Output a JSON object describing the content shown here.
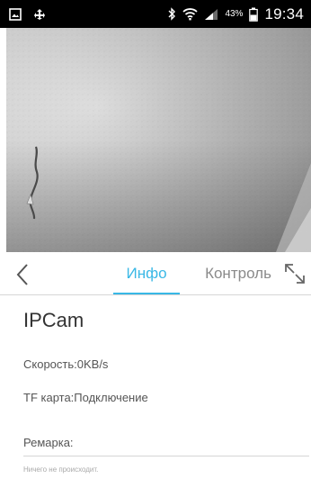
{
  "status_bar": {
    "battery_percent": "43%",
    "time": "19:34",
    "icons": [
      "gallery-icon",
      "usb-icon",
      "bluetooth-icon",
      "wifi-icon",
      "signal-icon",
      "battery-icon"
    ]
  },
  "camera": {
    "description_colors": {
      "wall": "#cfcfcf",
      "shadow": "#a8a8a8"
    }
  },
  "tabs": {
    "back_icon": "chevron-left-icon",
    "info_label": "Инфо",
    "control_label": "Контроль",
    "fullscreen_icon": "fullscreen-icon",
    "active": "Инфо"
  },
  "info": {
    "device_name": "IPCam",
    "speed": "Скорость:0KB/s",
    "tf_card": "TF карта:Подключение",
    "remark_label": "Ремарка:",
    "remark_placeholder": "Ничего не происходит."
  },
  "colors": {
    "accent": "#39b8e6",
    "text_primary": "#333333",
    "text_secondary": "#555555",
    "inactive_tab": "#8a8a8a"
  }
}
